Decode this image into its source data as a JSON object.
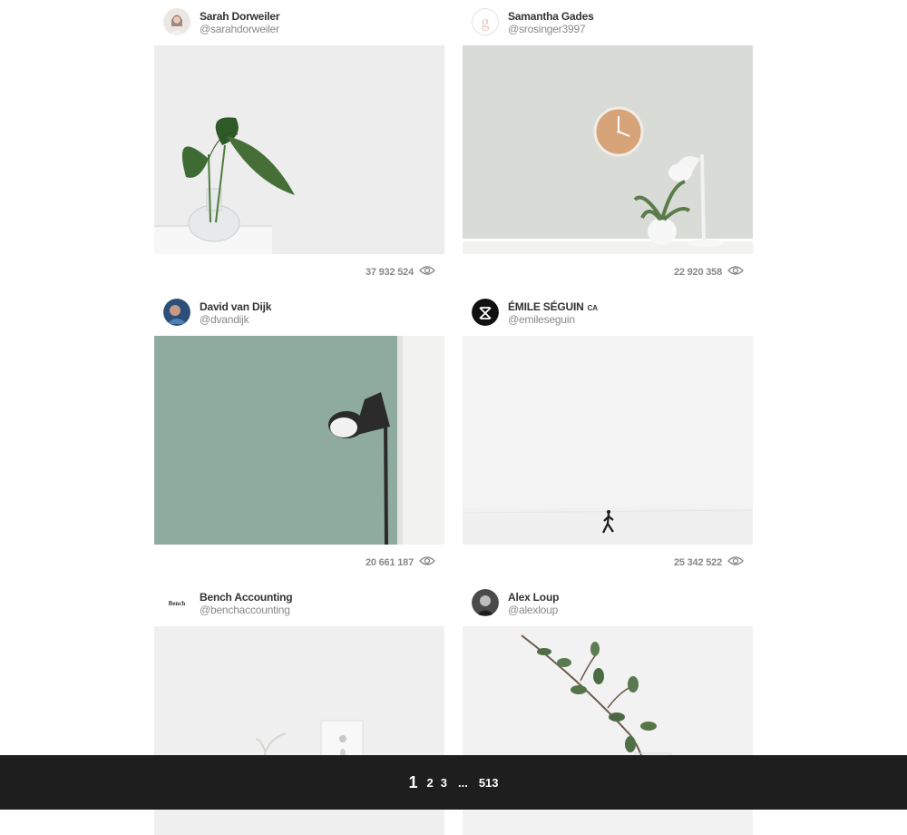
{
  "posts": [
    {
      "author": "Sarah Dorweiler",
      "handle": "@sarahdorweiler",
      "views": "37 932 524",
      "photo_icon": "monstera-leaves-in-glass-vase"
    },
    {
      "author": "Samantha Gades",
      "handle": "@srosinger3997",
      "views": "22 920 358",
      "photo_icon": "wall-clock-lamp-plant"
    },
    {
      "author": "David van Dijk",
      "handle": "@dvandijk",
      "views": "20 661 187",
      "photo_icon": "black-floor-lamp-green-wall"
    },
    {
      "author": "ÉMILE SÉGUIN",
      "author_badge": "CA",
      "handle": "@emileseguin",
      "views": "25 342 522",
      "photo_icon": "person-walking-snow"
    },
    {
      "author": "Bench Accounting",
      "handle": "@benchaccounting",
      "avatar_text": "Bench",
      "photo_icon": "white-room-chair-frame"
    },
    {
      "author": "Alex Loup",
      "handle": "@alexloup",
      "photo_icon": "eucalyptus-branch-vase"
    }
  ],
  "pagination": {
    "current": "1",
    "pages": [
      "2",
      "3"
    ],
    "ellipsis": "...",
    "last": "513"
  },
  "icons": {
    "views": "eye-icon"
  },
  "colors": {
    "pager_bg": "#1e1e1e",
    "meta_text": "#888888",
    "name_text": "#333333"
  }
}
